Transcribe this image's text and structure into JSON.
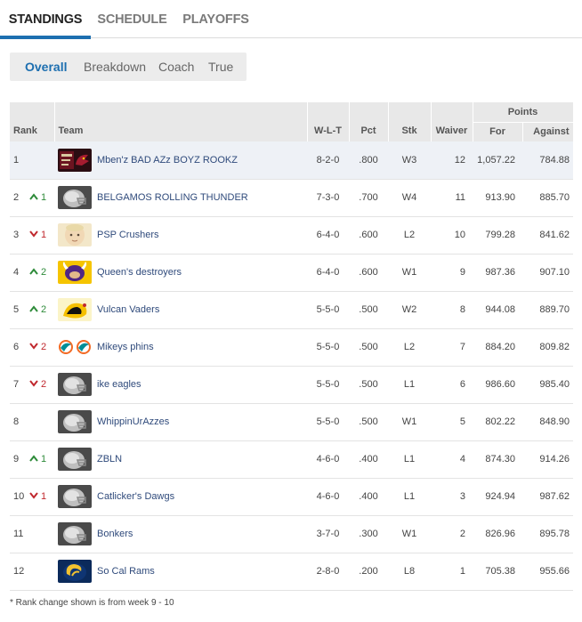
{
  "tabs": [
    {
      "label": "STANDINGS",
      "active": true
    },
    {
      "label": "SCHEDULE",
      "active": false
    },
    {
      "label": "PLAYOFFS",
      "active": false
    }
  ],
  "subnav": [
    {
      "label": "Overall",
      "active": true
    },
    {
      "label": "Breakdown",
      "active": false
    },
    {
      "label": "Coach",
      "active": false
    },
    {
      "label": "True",
      "active": false
    }
  ],
  "table": {
    "headers": {
      "rank": "Rank",
      "team": "Team",
      "wlt": "W-L-T",
      "pct": "Pct",
      "stk": "Stk",
      "waiver": "Waiver",
      "points": "Points",
      "for": "For",
      "against": "Against"
    },
    "rows": [
      {
        "rank": "1",
        "change": "",
        "dir": "",
        "logo": "cardinals",
        "team": "Mben'z BAD AZz BOYZ ROOKZ",
        "wlt": "8-2-0",
        "pct": ".800",
        "stk": "W3",
        "waiver": "12",
        "pf": "1,057.22",
        "pa": "784.88"
      },
      {
        "rank": "2",
        "change": "1",
        "dir": "up",
        "logo": "helmet",
        "team": "BELGAMOS ROLLING THUNDER",
        "wlt": "7-3-0",
        "pct": ".700",
        "stk": "W4",
        "waiver": "11",
        "pf": "913.90",
        "pa": "885.70"
      },
      {
        "rank": "3",
        "change": "1",
        "dir": "down",
        "logo": "baby",
        "team": "PSP Crushers",
        "wlt": "6-4-0",
        "pct": ".600",
        "stk": "L2",
        "waiver": "10",
        "pf": "799.28",
        "pa": "841.62"
      },
      {
        "rank": "4",
        "change": "2",
        "dir": "up",
        "logo": "vikings",
        "team": "Queen's destroyers",
        "wlt": "6-4-0",
        "pct": ".600",
        "stk": "W1",
        "waiver": "9",
        "pf": "987.36",
        "pa": "907.10"
      },
      {
        "rank": "5",
        "change": "2",
        "dir": "up",
        "logo": "steelers",
        "team": "Vulcan Vaders",
        "wlt": "5-5-0",
        "pct": ".500",
        "stk": "W2",
        "waiver": "8",
        "pf": "944.08",
        "pa": "889.70"
      },
      {
        "rank": "6",
        "change": "2",
        "dir": "down",
        "logo": "dolphins",
        "team": "Mikeys phins",
        "wlt": "5-5-0",
        "pct": ".500",
        "stk": "L2",
        "waiver": "7",
        "pf": "884.20",
        "pa": "809.82"
      },
      {
        "rank": "7",
        "change": "2",
        "dir": "down",
        "logo": "helmet",
        "team": "ike eagles",
        "wlt": "5-5-0",
        "pct": ".500",
        "stk": "L1",
        "waiver": "6",
        "pf": "986.60",
        "pa": "985.40"
      },
      {
        "rank": "8",
        "change": "",
        "dir": "",
        "logo": "helmet",
        "team": "WhippinUrAzzes",
        "wlt": "5-5-0",
        "pct": ".500",
        "stk": "W1",
        "waiver": "5",
        "pf": "802.22",
        "pa": "848.90"
      },
      {
        "rank": "9",
        "change": "1",
        "dir": "up",
        "logo": "helmet",
        "team": "ZBLN",
        "wlt": "4-6-0",
        "pct": ".400",
        "stk": "L1",
        "waiver": "4",
        "pf": "874.30",
        "pa": "914.26"
      },
      {
        "rank": "10",
        "change": "1",
        "dir": "down",
        "logo": "helmet",
        "team": "Catlicker's Dawgs",
        "wlt": "4-6-0",
        "pct": ".400",
        "stk": "L1",
        "waiver": "3",
        "pf": "924.94",
        "pa": "987.62"
      },
      {
        "rank": "11",
        "change": "",
        "dir": "",
        "logo": "helmet",
        "team": "Bonkers",
        "wlt": "3-7-0",
        "pct": ".300",
        "stk": "W1",
        "waiver": "2",
        "pf": "826.96",
        "pa": "895.78"
      },
      {
        "rank": "12",
        "change": "",
        "dir": "",
        "logo": "rams",
        "team": "So Cal Rams",
        "wlt": "2-8-0",
        "pct": ".200",
        "stk": "L8",
        "waiver": "1",
        "pf": "705.38",
        "pa": "955.66"
      }
    ]
  },
  "footnote": "* Rank change shown is from week 9 - 10",
  "colors": {
    "accent": "#1d6fb0",
    "up": "#2e8b3a",
    "down": "#c0282e",
    "team_link": "#2f4a7b"
  }
}
